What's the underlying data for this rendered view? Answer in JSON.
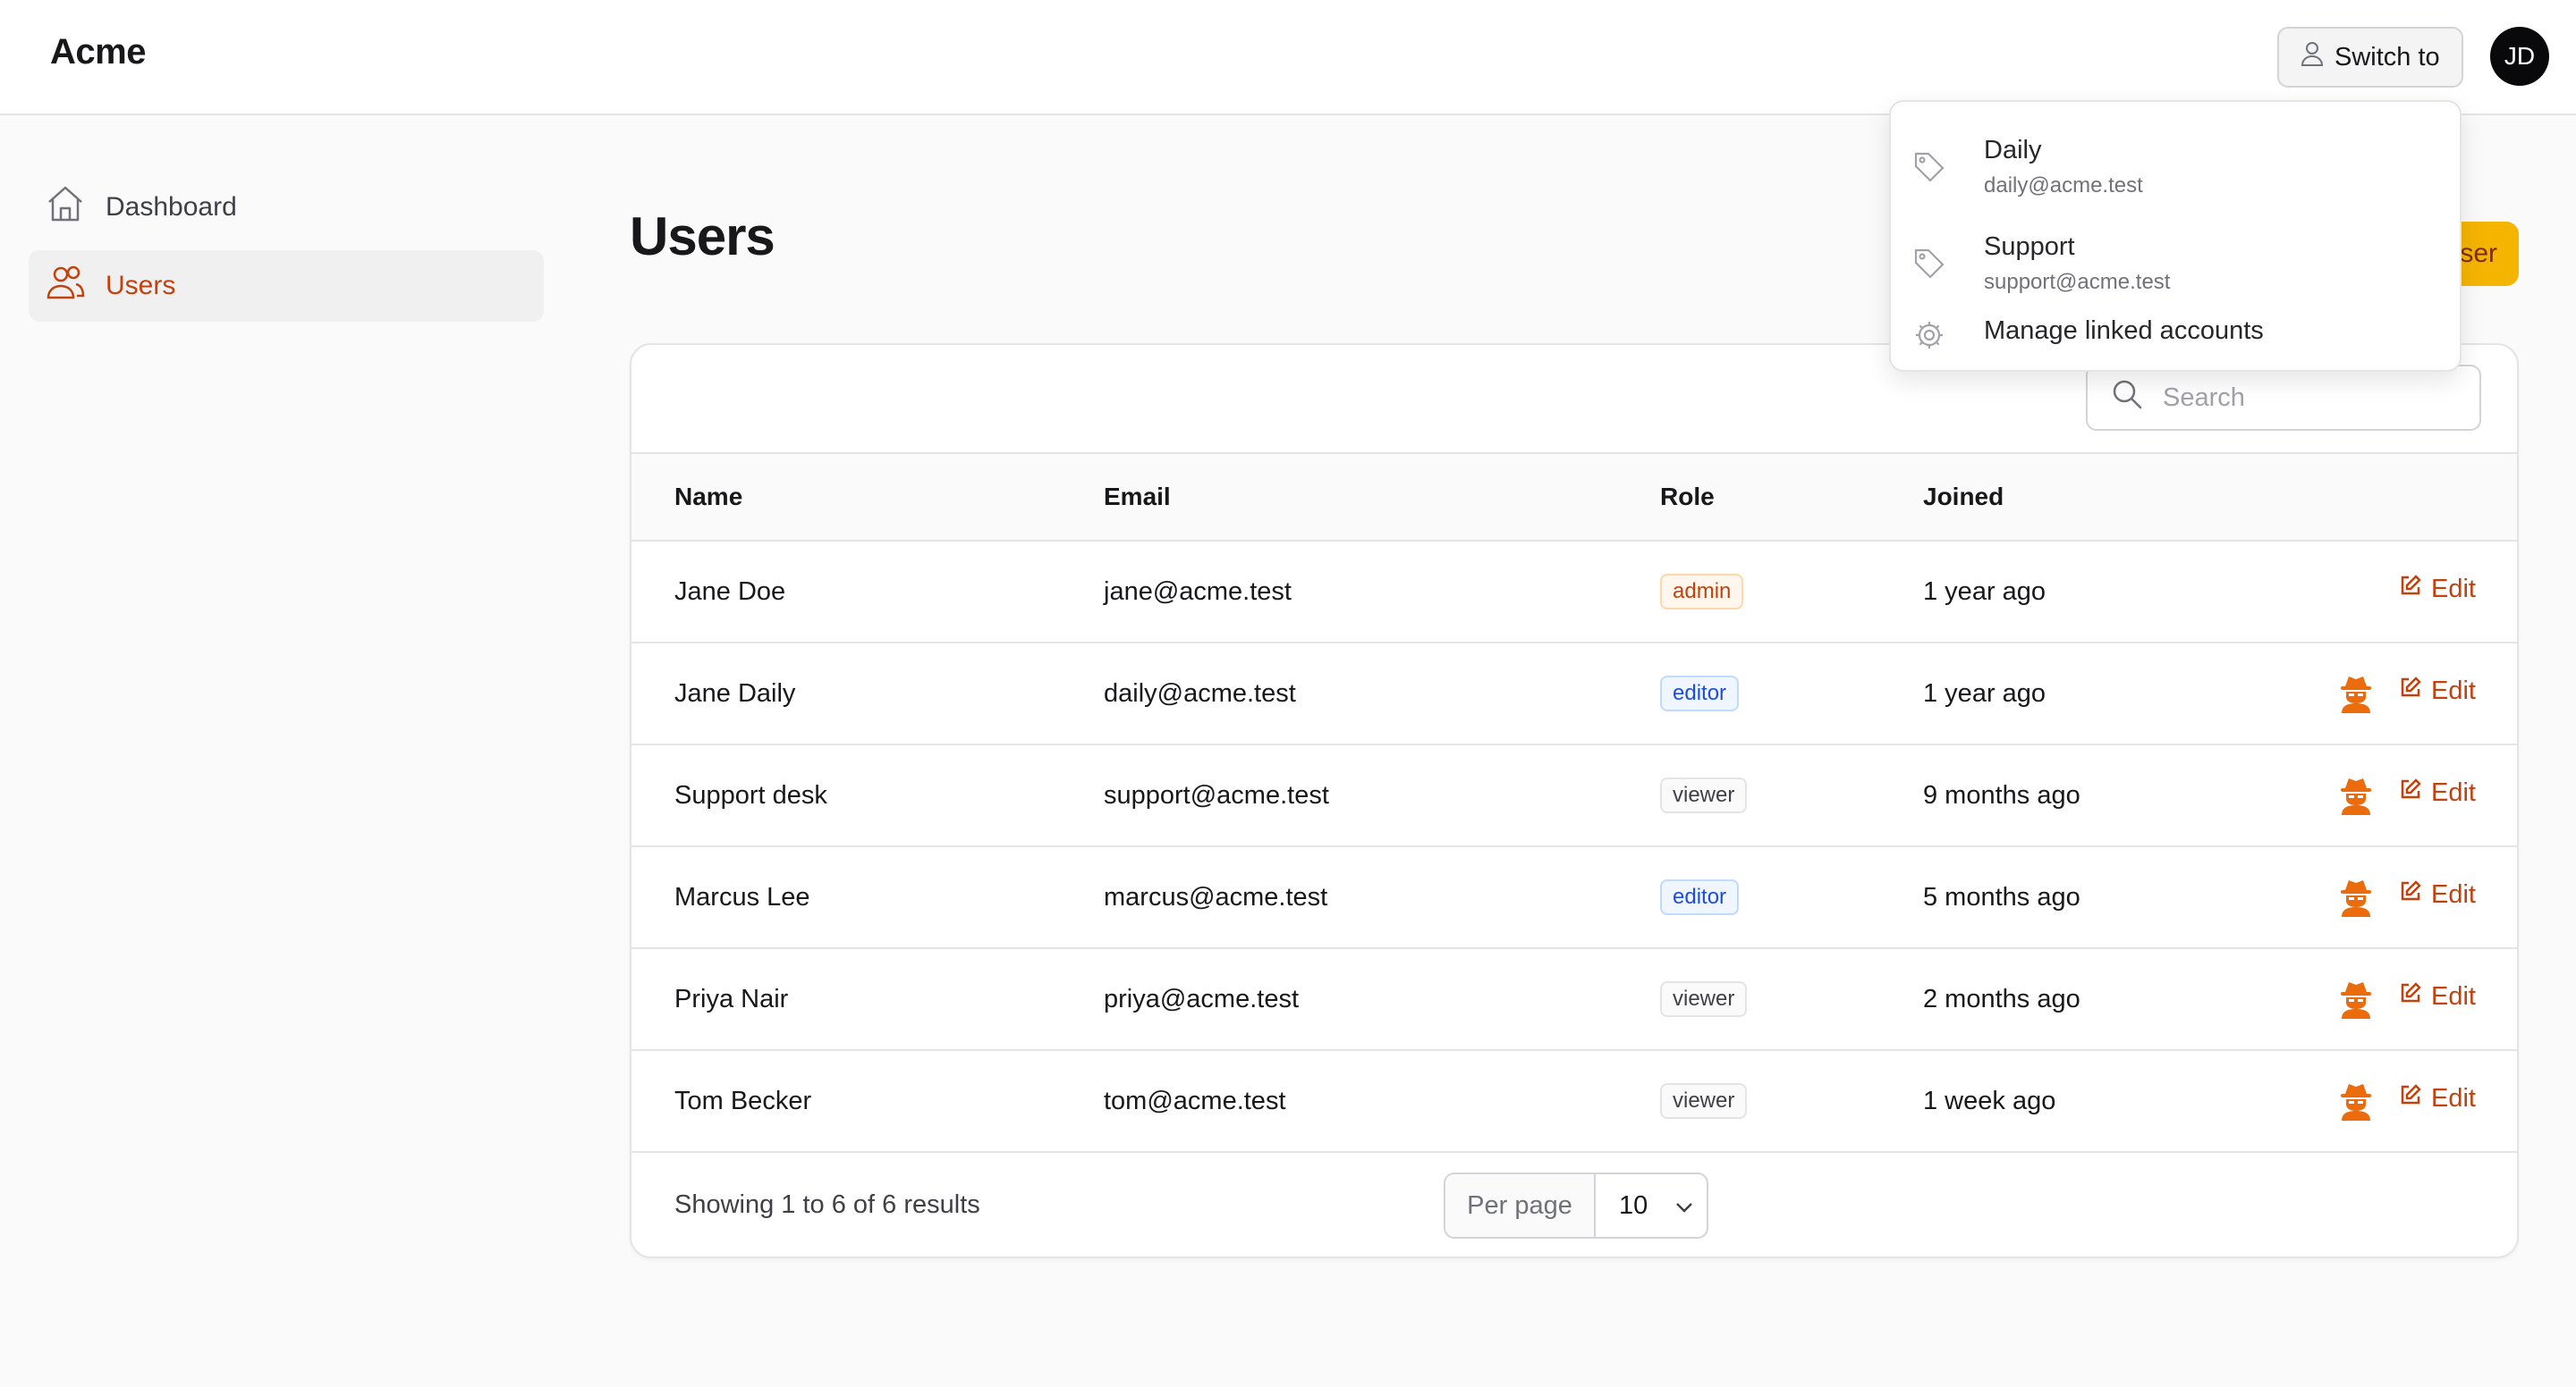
{
  "app": {
    "brand": "Acme"
  },
  "header": {
    "switch_label": "Switch to",
    "avatar_initials": "JD"
  },
  "sidebar": {
    "items": [
      {
        "label": "Dashboard",
        "icon": "home-icon",
        "active": false
      },
      {
        "label": "Users",
        "icon": "users-icon",
        "active": true
      }
    ]
  },
  "page": {
    "title": "Users",
    "new_user_label": "New user",
    "new_user_visible_text": "ser"
  },
  "search": {
    "placeholder": "Search"
  },
  "table": {
    "columns": [
      "Name",
      "Email",
      "Role",
      "Joined"
    ],
    "rows": [
      {
        "name": "Jane Doe",
        "email": "jane@acme.test",
        "role": "admin",
        "joined": "1 year ago",
        "can_impersonate": false
      },
      {
        "name": "Jane Daily",
        "email": "daily@acme.test",
        "role": "editor",
        "joined": "1 year ago",
        "can_impersonate": true
      },
      {
        "name": "Support desk",
        "email": "support@acme.test",
        "role": "viewer",
        "joined": "9 months ago",
        "can_impersonate": true
      },
      {
        "name": "Marcus Lee",
        "email": "marcus@acme.test",
        "role": "editor",
        "joined": "5 months ago",
        "can_impersonate": true
      },
      {
        "name": "Priya Nair",
        "email": "priya@acme.test",
        "role": "viewer",
        "joined": "2 months ago",
        "can_impersonate": true
      },
      {
        "name": "Tom Becker",
        "email": "tom@acme.test",
        "role": "viewer",
        "joined": "1 week ago",
        "can_impersonate": true
      }
    ],
    "edit_label": "Edit"
  },
  "footer": {
    "results_text": "Showing 1 to 6 of 6 results",
    "per_page_label": "Per page",
    "per_page_value": "10"
  },
  "dropdown": {
    "accounts": [
      {
        "name": "Daily",
        "email": "daily@acme.test",
        "icon": "tag-icon"
      },
      {
        "name": "Support",
        "email": "support@acme.test",
        "icon": "tag-icon"
      }
    ],
    "manage_label": "Manage linked accounts",
    "manage_icon": "gear-icon"
  },
  "colors": {
    "accent": "#c2410c",
    "primary_button": "#f5b400",
    "admin_badge": "#c2410c",
    "editor_badge": "#1d4ed8",
    "viewer_badge": "#3f3f46"
  }
}
